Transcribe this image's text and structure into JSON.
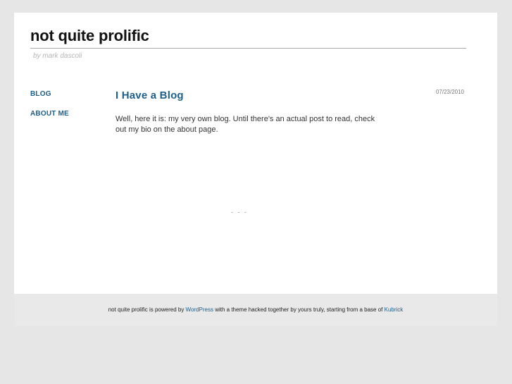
{
  "site": {
    "title": "not quite prolific",
    "byline": "by mark dascoli"
  },
  "nav": {
    "items": [
      {
        "label": "BLOG"
      },
      {
        "label": "ABOUT ME"
      }
    ]
  },
  "post": {
    "title": "I Have a Blog",
    "date": "07/23/2010",
    "body": "Well, here it is: my very own blog. Until there's an actual post to read, check out my bio on the about page."
  },
  "separator": "- - -",
  "footer": {
    "prefix": "not quite prolific is powered by ",
    "wordpress_link": "WordPress",
    "middle": " with a theme hacked together by yours truly, starting from a base of ",
    "kubrick_link": "Kubrick"
  },
  "colors": {
    "background": "#e6e6e6",
    "page": "#ffffff",
    "link": "#1d5f8a"
  }
}
